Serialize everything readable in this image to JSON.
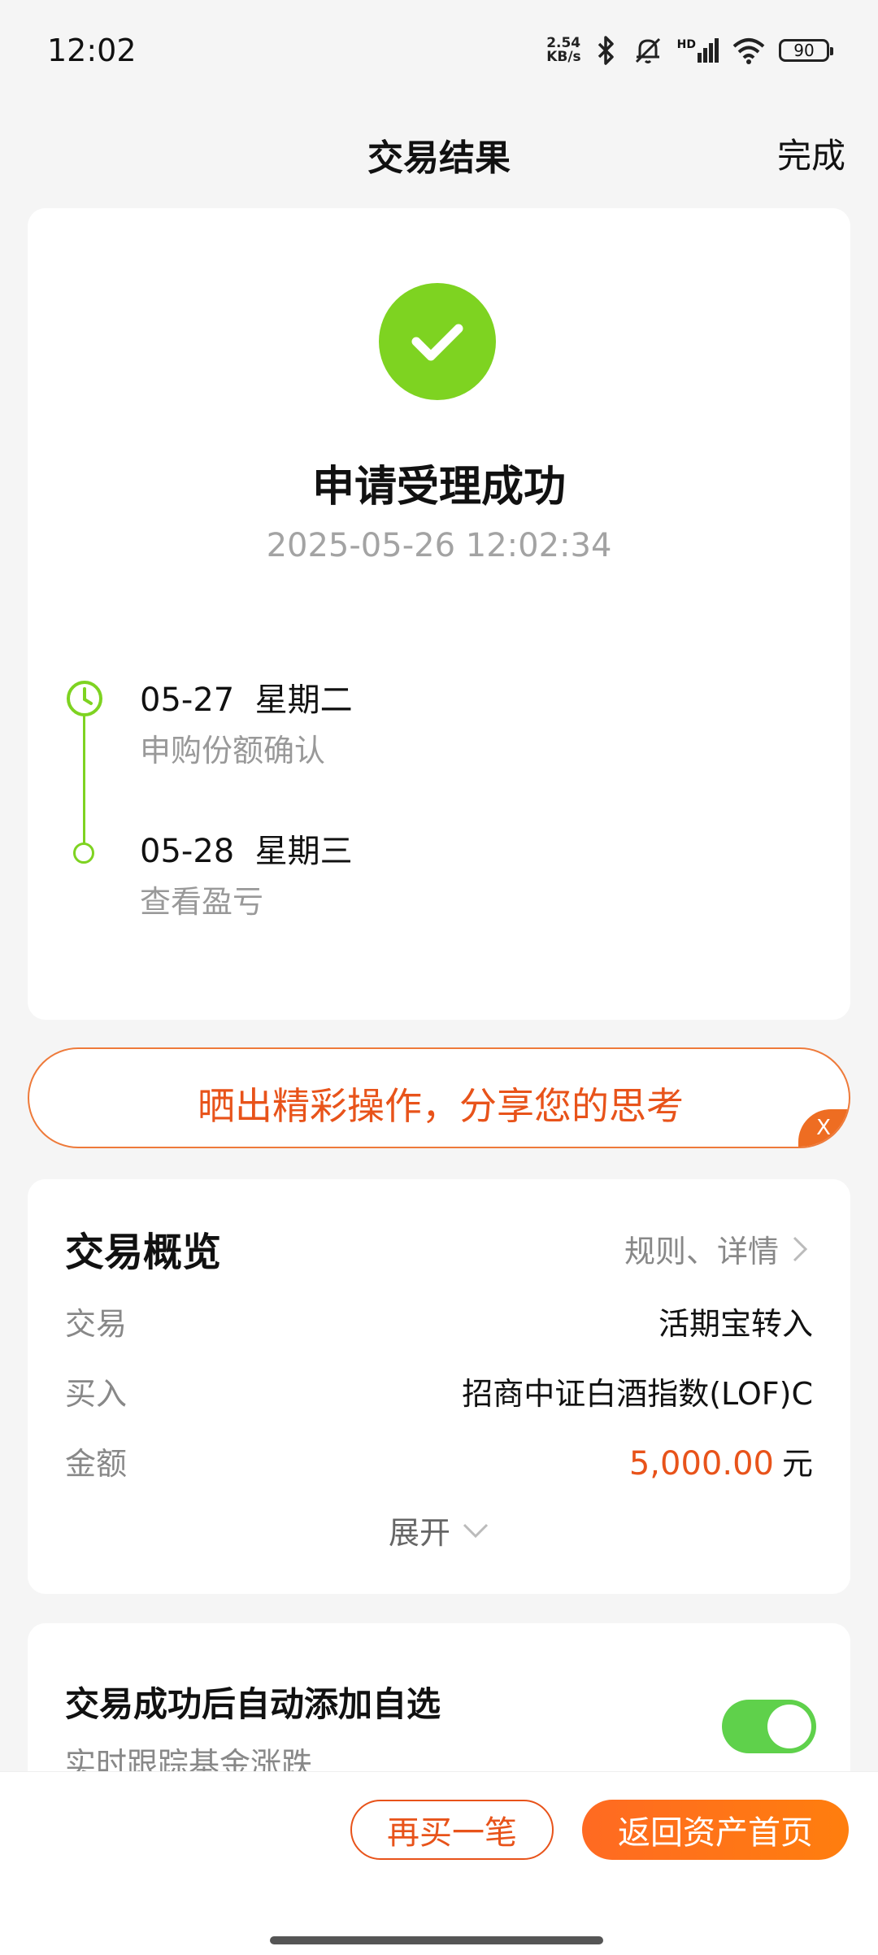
{
  "status_bar": {
    "time": "12:02",
    "net_speed_value": "2.54",
    "net_speed_unit": "KB/s",
    "network_label": "HD",
    "battery": "90"
  },
  "header": {
    "title": "交易结果",
    "done_label": "完成"
  },
  "result": {
    "title": "申请受理成功",
    "timestamp": "2025-05-26 12:02:34",
    "timeline": [
      {
        "date": "05-27  星期二",
        "desc": "申购份额确认"
      },
      {
        "date": "05-28  星期三",
        "desc": "查看盈亏"
      }
    ]
  },
  "share": {
    "text": "晒出精彩操作，分享您的思考",
    "close_label": "X"
  },
  "overview": {
    "title": "交易概览",
    "rules_link": "规则、详情",
    "rows": [
      {
        "label": "交易",
        "value": "活期宝转入"
      },
      {
        "label": "买入",
        "value": "招商中证白酒指数(LOF)C"
      }
    ],
    "amount_label": "金额",
    "amount_value": "5,000.00",
    "amount_unit": "元",
    "expand_label": "展开"
  },
  "auto_add": {
    "title": "交易成功后自动添加自选",
    "subtitle": "实时跟踪基金涨跌",
    "enabled": true
  },
  "actions": {
    "buy_again": "再买一笔",
    "back_home": "返回资产首页"
  },
  "colors": {
    "success": "#7ed321",
    "accent": "#e8531a",
    "toggle_on": "#5fd14b"
  }
}
